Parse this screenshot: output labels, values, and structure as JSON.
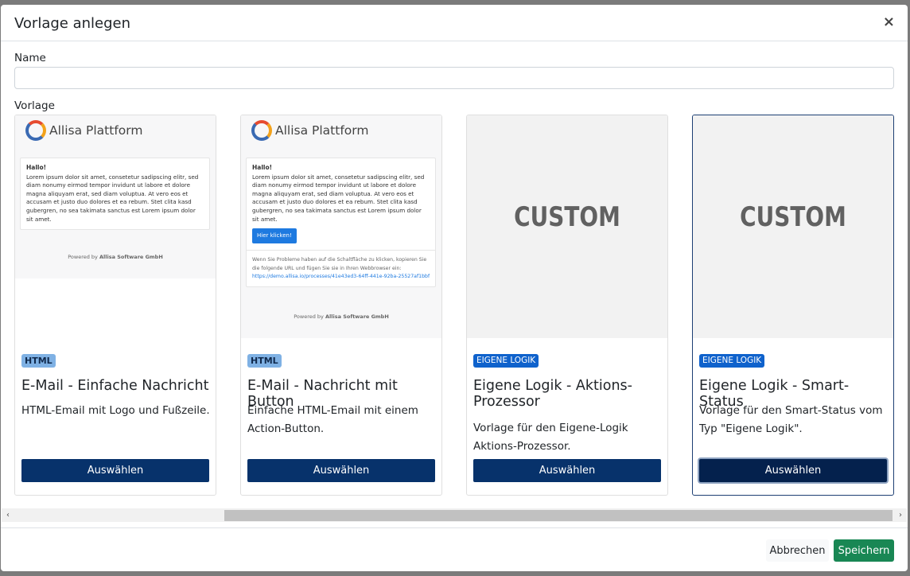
{
  "dialog": {
    "title": "Vorlage anlegen",
    "close_symbol": "×"
  },
  "form": {
    "name_label": "Name",
    "name_value": "",
    "template_label": "Vorlage"
  },
  "templates": [
    {
      "badge": "HTML",
      "title": "E-Mail - Einfache Nachricht",
      "description": "HTML-Email mit Logo und Fußzeile.",
      "button": "Auswählen",
      "preview": {
        "logo_text": "Allisa Plattform",
        "greeting": "Hallo!",
        "body": "Lorem ipsum dolor sit amet, consetetur sadipscing elitr, sed diam nonumy eirmod tempor invidunt ut labore et dolore magna aliquyam erat, sed diam voluptua. At vero eos et accusam et justo duo dolores et ea rebum. Stet clita kasd gubergren, no sea takimata sanctus est Lorem ipsum dolor sit amet.",
        "powered_prefix": "Powered by",
        "powered_company": "Allisa Software GmbH"
      }
    },
    {
      "badge": "HTML",
      "title": "E-Mail - Nachricht mit Button",
      "description": "Einfache HTML-Email mit einem Action-Button.",
      "button": "Auswählen",
      "preview": {
        "logo_text": "Allisa Plattform",
        "greeting": "Hallo!",
        "body": "Lorem ipsum dolor sit amet, consetetur sadipscing elitr, sed diam nonumy eirmod tempor invidunt ut labore et dolore magna aliquyam erat, sed diam voluptua. At vero eos et accusam et justo duo dolores et ea rebum. Stet clita kasd gubergren, no sea takimata sanctus est Lorem ipsum dolor sit amet.",
        "action_button": "Hier klicken!",
        "help_text": "Wenn Sie Probleme haben auf die Schaltfläche zu klicken, kopieren Sie die folgende URL und fügen Sie sie in Ihren Webbrowser ein:",
        "link": "https://demo.allisa.io/processes/41e43ed3-64ff-441e-92ba-25527af1bbfb",
        "powered_prefix": "Powered by",
        "powered_company": "Allisa Software GmbH"
      }
    },
    {
      "badge": "EIGENE LOGIK",
      "title": "Eigene Logik - Aktions-Prozessor",
      "description": "Vorlage für den Eigene-Logik Aktions-Prozessor.",
      "button": "Auswählen",
      "preview": {
        "custom_text": "CUSTOM"
      }
    },
    {
      "badge": "EIGENE LOGIK",
      "title": "Eigene Logik - Smart-Status",
      "description": "Vorlage für den Smart-Status vom Typ \"Eigene Logik\".",
      "button": "Auswählen",
      "preview": {
        "custom_text": "CUSTOM"
      }
    }
  ],
  "scrollbar": {
    "left_arrow": "‹",
    "right_arrow": "›"
  },
  "footer": {
    "cancel": "Abbrechen",
    "save": "Speichern"
  },
  "colors": {
    "primary_button": "#07326b",
    "save_button": "#198754",
    "badge_html": "#7fb1e4",
    "badge_logic": "#0f62cc"
  }
}
